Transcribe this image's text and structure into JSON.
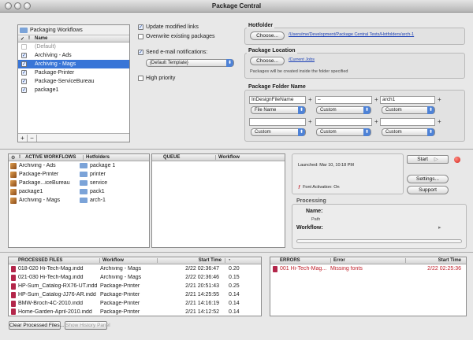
{
  "window": {
    "title": "Package Central"
  },
  "workflows": {
    "header": "Packaging Workflows",
    "col_name": "Name",
    "items": [
      {
        "label": "(Default)",
        "checked": false,
        "disabled": true
      },
      {
        "label": "Archiving - Ads",
        "checked": true
      },
      {
        "label": "Archiving - Mags",
        "checked": true
      },
      {
        "label": "Package-Printer",
        "checked": true
      },
      {
        "label": "Package-ServiceBureau",
        "checked": true
      },
      {
        "label": "package1",
        "checked": true
      }
    ],
    "add_label": "+",
    "remove_label": "−"
  },
  "options": {
    "update_links": "Update modified links",
    "overwrite": "Overwrite existing packages",
    "send_email": "Send e-mail notifications:",
    "template": "{Default Template}",
    "high_priority": "High priority"
  },
  "hotfolder": {
    "title": "Hotfolder",
    "choose": "Choose...",
    "path": "/Users/me/Development/Package Central Tests/Hotfolders/arch-1"
  },
  "package_location": {
    "title": "Package Location",
    "choose": "Choose...",
    "path": "/Current Jobs",
    "note": "Packages will be created inside the folder specified"
  },
  "folder_name": {
    "title": "Package Folder Name",
    "row1": {
      "field1": "InDesignFileName",
      "field2": "–",
      "field3": "arch1",
      "select1": "File Name",
      "select2": "Custom",
      "select3": "Custom"
    },
    "row2": {
      "field1": "",
      "field2": "",
      "field3": "",
      "select1": "Custom",
      "select2": "Custom",
      "select3": "Custom"
    },
    "plus": "+"
  },
  "active": {
    "header_workflows": "ACTIVE WORKFLOWS",
    "header_hotfolders": "Hotfolders",
    "rows": [
      {
        "workflow": "Archiving - Ads",
        "hotfolder": "package 1"
      },
      {
        "workflow": "Package-Printer",
        "hotfolder": "printer"
      },
      {
        "workflow": "Package...iceBureau",
        "hotfolder": "service"
      },
      {
        "workflow": "package1",
        "hotfolder": "pack1"
      },
      {
        "workflow": "Archiving - Mags",
        "hotfolder": "arch-1"
      }
    ]
  },
  "queue": {
    "header_queue": "QUEUE",
    "header_workflow": "Workflow"
  },
  "status": {
    "launched": "Launched: Mar 10, 10:18 PM",
    "font_activation": "Font Activation: On"
  },
  "controls": {
    "start": "Start",
    "settings": "Settings...",
    "support": "Support"
  },
  "processing": {
    "title": "Processing",
    "name_label": "Name:",
    "path_label": "Path",
    "workflow_label": "Workflow:"
  },
  "processed": {
    "header_files": "PROCESSED FILES",
    "header_workflow": "Workflow",
    "header_start": "Start Time",
    "rows": [
      {
        "file": "018-020 Hi-Tech-Mag.indd",
        "workflow": "Archiving - Mags",
        "start": "2/22 02:36:47",
        "time": "0.20"
      },
      {
        "file": "021-030 Hi-Tech-Mag.indd",
        "workflow": "Archiving - Mags",
        "start": "2/22 02:36:46",
        "time": "0.15"
      },
      {
        "file": "HP-Sum_Catalog-RX76-UT.indd",
        "workflow": "Package-Printer",
        "start": "2/21 20:51:43",
        "time": "0.25"
      },
      {
        "file": "HP-Sum_Catalog-JJ76-AR.indd",
        "workflow": "Package-Printer",
        "start": "2/21 14:25:55",
        "time": "0.14"
      },
      {
        "file": "BMW-Broch-4C-2010.indd",
        "workflow": "Package-Printer",
        "start": "2/21 14:16:19",
        "time": "0.14"
      },
      {
        "file": "Home-Garden-April-2010.indd",
        "workflow": "Package-Printer",
        "start": "2/21 14:12:52",
        "time": "0.14"
      }
    ]
  },
  "errors": {
    "header_errors": "ERRORS",
    "header_error": "Error",
    "header_start": "Start Time",
    "rows": [
      {
        "file": "001 Hi-Tech-Mag...",
        "error": "Missing fonts",
        "start": "2/22 02:25:36"
      }
    ]
  },
  "footer": {
    "clear": "Clear Processed Files...",
    "history": "Show History Panel"
  },
  "colors": {
    "selection": "#3875d7",
    "error_red": "#c0212c",
    "link_blue": "#1a3fb5"
  },
  "icons": [
    "checkmark-icon",
    "folder-icon",
    "workflow-icon",
    "indd-file-icon",
    "font-icon",
    "record-icon",
    "play-icon",
    "gear-icon"
  ]
}
